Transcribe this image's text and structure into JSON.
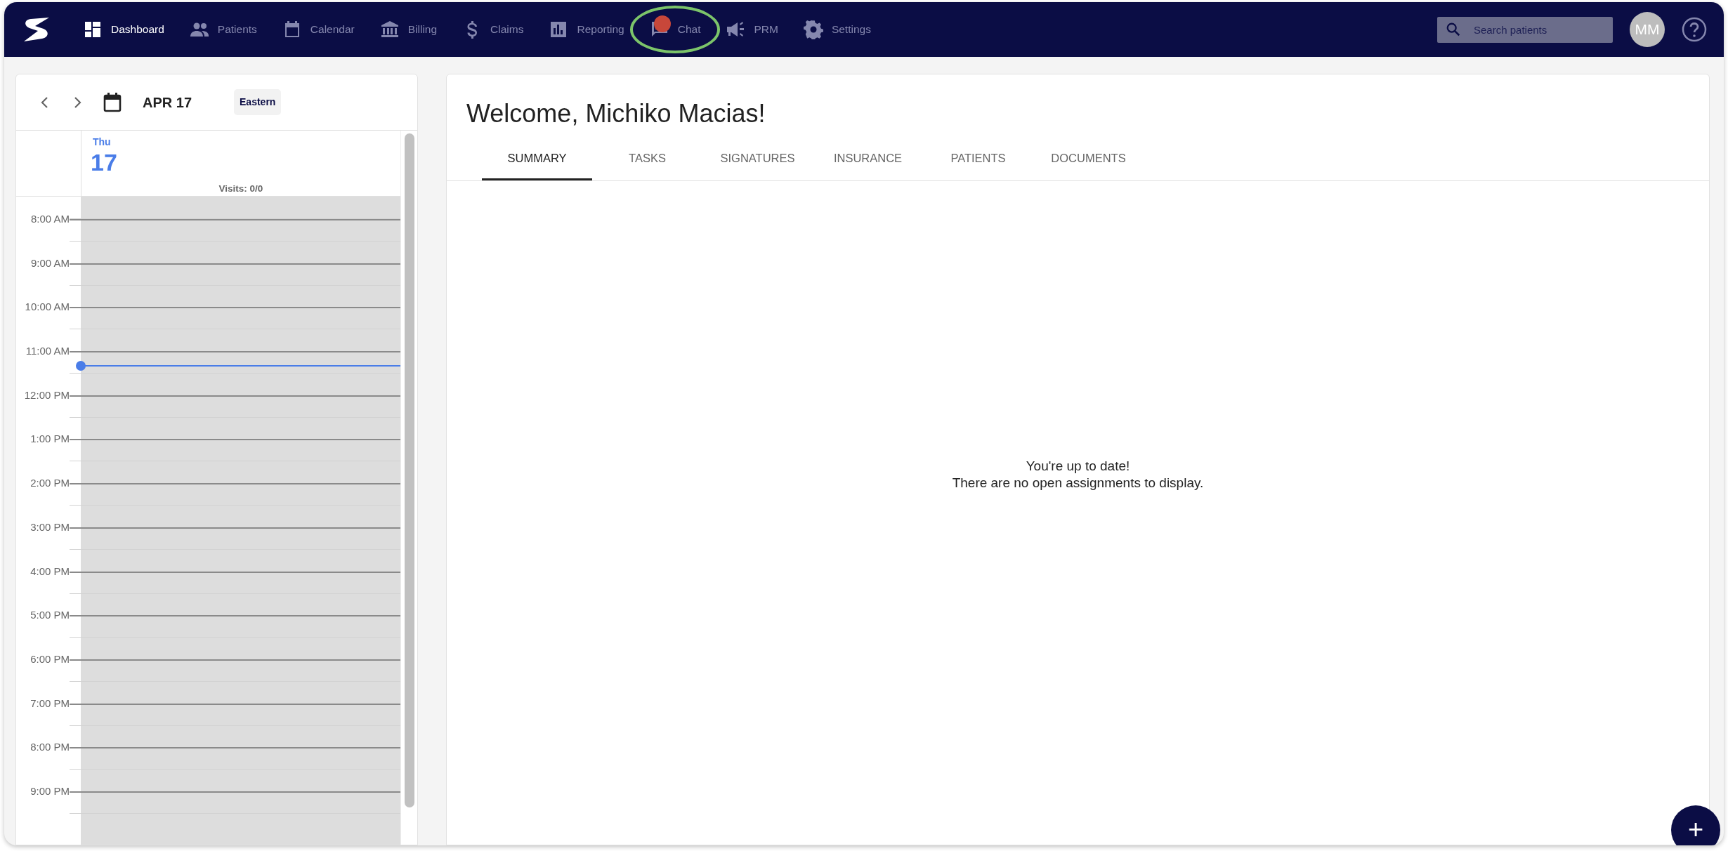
{
  "navbar": {
    "items": [
      {
        "label": "Dashboard",
        "selected": true
      },
      {
        "label": "Patients",
        "selected": false
      },
      {
        "label": "Calendar",
        "selected": false
      },
      {
        "label": "Billing",
        "selected": false
      },
      {
        "label": "Claims",
        "selected": false
      },
      {
        "label": "Reporting",
        "selected": false
      },
      {
        "label": "Chat",
        "selected": false,
        "notification": true,
        "highlighted": true
      },
      {
        "label": "PRM",
        "selected": false
      },
      {
        "label": "Settings",
        "selected": false
      }
    ],
    "search": {
      "placeholder": "Search patients"
    },
    "avatar": "MM"
  },
  "calendar": {
    "date": "APR 17",
    "timezone": "Eastern",
    "day_name": "Thu",
    "day_number": "17",
    "visits": "Visits: 0/0",
    "hours": [
      {
        "label": "8:00 AM"
      },
      {
        "label": "9:00 AM"
      },
      {
        "label": "10:00 AM"
      },
      {
        "label": "11:00 AM",
        "current": true
      },
      {
        "label": "12:00 PM"
      },
      {
        "label": "1:00 PM"
      },
      {
        "label": "2:00 PM"
      },
      {
        "label": "3:00 PM"
      },
      {
        "label": "4:00 PM"
      },
      {
        "label": "5:00 PM"
      },
      {
        "label": "6:00 PM"
      },
      {
        "label": "7:00 PM"
      },
      {
        "label": "8:00 PM"
      },
      {
        "label": "9:00 PM"
      }
    ]
  },
  "main": {
    "title": "Welcome, Michiko Macias!",
    "tabs": [
      {
        "label": "SUMMARY",
        "selected": true
      },
      {
        "label": "TASKS",
        "selected": false
      },
      {
        "label": "SIGNATURES",
        "selected": false
      },
      {
        "label": "INSURANCE",
        "selected": false
      },
      {
        "label": "PATIENTS",
        "selected": false
      },
      {
        "label": "DOCUMENTS",
        "selected": false
      }
    ],
    "empty_message": [
      "You're up to date!",
      "There are no open assignments to display."
    ],
    "fab": "+"
  }
}
